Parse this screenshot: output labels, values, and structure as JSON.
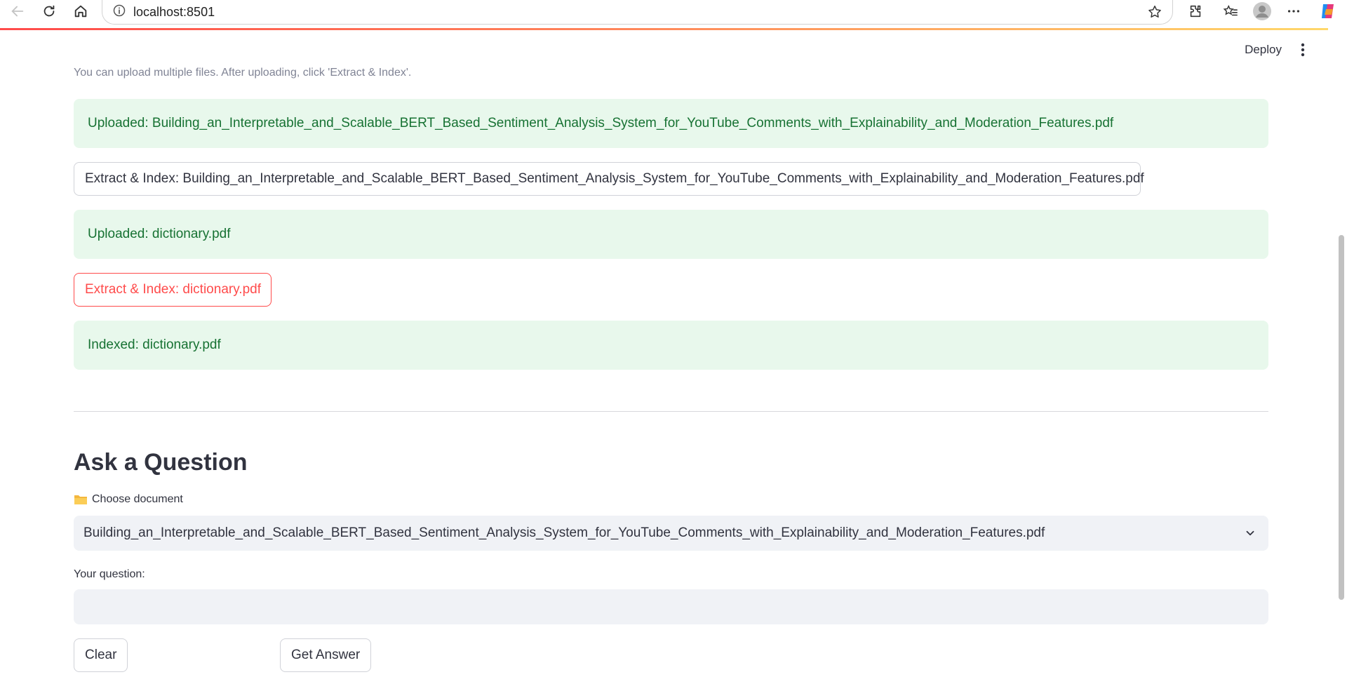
{
  "browser": {
    "url": "localhost:8501",
    "icons": [
      "back-icon",
      "refresh-icon",
      "home-icon",
      "info-icon",
      "star-icon",
      "extensions-icon",
      "favorites-icon",
      "profile-icon",
      "more-icon",
      "copilot-icon"
    ]
  },
  "header": {
    "deploy_label": "Deploy"
  },
  "upload": {
    "caption": "You can upload multiple files. After uploading, click 'Extract & Index'.",
    "messages": [
      "Uploaded: Building_an_Interpretable_and_Scalable_BERT_Based_Sentiment_Analysis_System_for_YouTube_Comments_with_Explainability_and_Moderation_Features.pdf",
      "Uploaded: dictionary.pdf",
      "Indexed: dictionary.pdf"
    ],
    "buttons": [
      "Extract & Index: Building_an_Interpretable_and_Scalable_BERT_Based_Sentiment_Analysis_System_for_YouTube_Comments_with_Explainability_and_Moderation_Features.pdf",
      "Extract & Index: dictionary.pdf"
    ]
  },
  "ask": {
    "title": "Ask a Question",
    "choose_label": "Choose document",
    "selected_document": "Building_an_Interpretable_and_Scalable_BERT_Based_Sentiment_Analysis_System_for_YouTube_Comments_with_Explainability_and_Moderation_Features.pdf",
    "question_label": "Your question:",
    "question_value": "",
    "clear_label": "Clear",
    "get_answer_label": "Get Answer"
  },
  "colors": {
    "accent": "#ff4b4b",
    "success_bg": "#e8f8ec",
    "success_text": "#177233",
    "input_bg": "#f0f2f6"
  }
}
